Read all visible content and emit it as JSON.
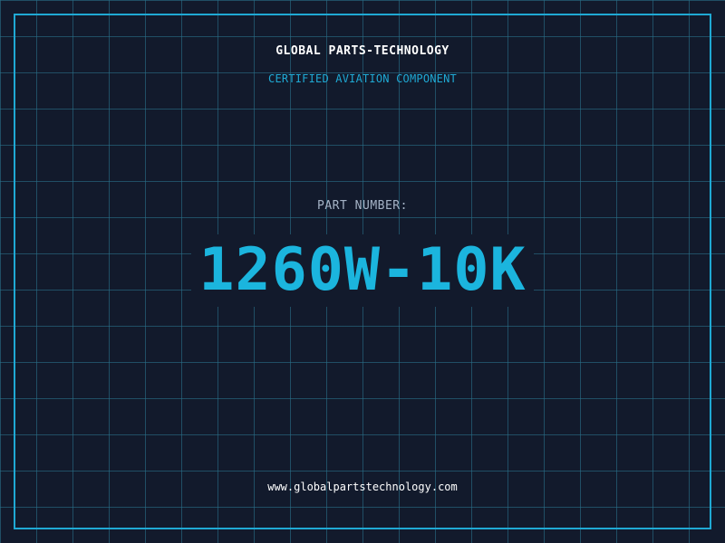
{
  "brand": {
    "title": "GLOBAL PARTS-TECHNOLOGY",
    "certification": "CERTIFIED AVIATION COMPONENT"
  },
  "part": {
    "label": "PART NUMBER:",
    "number": "1260W-10K"
  },
  "footer": {
    "website": "www.globalpartstechnology.com"
  },
  "colors": {
    "background": "#121a2c",
    "grid": "#286e87",
    "accent": "#1fa9d4",
    "part_number": "#1bb5de",
    "title": "#ffffff",
    "label": "#a5b3c6"
  }
}
